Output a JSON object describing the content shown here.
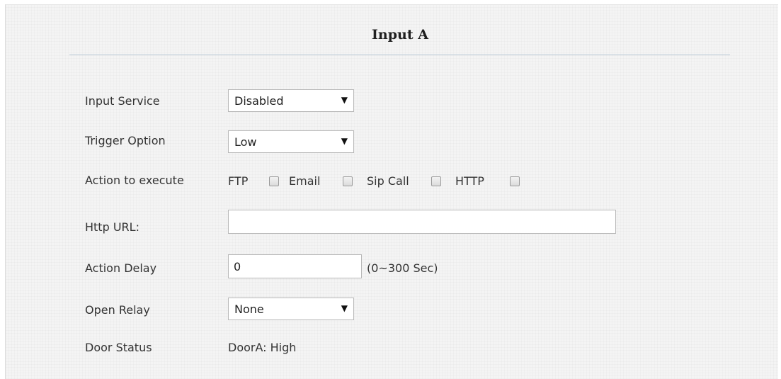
{
  "title": "Input A",
  "input_service": {
    "label": "Input Service",
    "value": "Disabled"
  },
  "trigger_option": {
    "label": "Trigger Option",
    "value": "Low"
  },
  "action_to_execute": {
    "label": "Action to execute",
    "options": [
      {
        "label": "FTP",
        "checked": false
      },
      {
        "label": "Email",
        "checked": false
      },
      {
        "label": "Sip Call",
        "checked": false
      },
      {
        "label": "HTTP",
        "checked": false
      }
    ]
  },
  "http_url": {
    "label": "Http URL:",
    "value": ""
  },
  "action_delay": {
    "label": "Action Delay",
    "value": "0",
    "hint": "(0~300 Sec)"
  },
  "open_relay": {
    "label": "Open Relay",
    "value": "None"
  },
  "door_status": {
    "label": "Door Status",
    "value": "DoorA: High"
  },
  "icons": {
    "dropdown_arrow": "▼"
  }
}
